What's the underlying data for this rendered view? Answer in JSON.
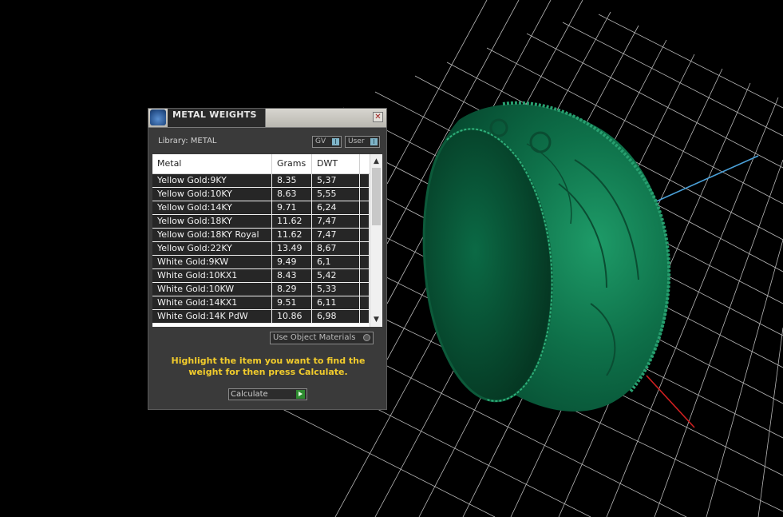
{
  "window": {
    "title": "METAL WEIGHTS",
    "close_label": "✕"
  },
  "library": {
    "label": "Library: METAL",
    "toggle_gv": "GV",
    "toggle_user": "User",
    "toggle_indicator": "I"
  },
  "table": {
    "headers": [
      "Metal",
      "Grams",
      "DWT"
    ],
    "rows": [
      {
        "metal": "Yellow Gold:9KY",
        "grams": "8.35",
        "dwt": "5,37"
      },
      {
        "metal": "Yellow Gold:10KY",
        "grams": "8.63",
        "dwt": "5,55"
      },
      {
        "metal": "Yellow Gold:14KY",
        "grams": "9.71",
        "dwt": "6,24"
      },
      {
        "metal": "Yellow Gold:18KY",
        "grams": "11.62",
        "dwt": "7,47"
      },
      {
        "metal": "Yellow Gold:18KY Royal",
        "grams": "11.62",
        "dwt": "7,47"
      },
      {
        "metal": "Yellow Gold:22KY",
        "grams": "13.49",
        "dwt": "8,67"
      },
      {
        "metal": "White Gold:9KW",
        "grams": "9.49",
        "dwt": "6,1"
      },
      {
        "metal": "White Gold:10KX1",
        "grams": "8.43",
        "dwt": "5,42"
      },
      {
        "metal": "White Gold:10KW",
        "grams": "8.29",
        "dwt": "5,33"
      },
      {
        "metal": "White Gold:14KX1",
        "grams": "9.51",
        "dwt": "6,11"
      },
      {
        "metal": "White Gold:14K PdW",
        "grams": "10.86",
        "dwt": "6,98"
      }
    ]
  },
  "use_object_materials": "Use Object Materials",
  "instruction": "Highlight the item you want to find the weight for then press Calculate.",
  "calculate_label": "Calculate",
  "colors": {
    "panel_bg": "#3a3a3a",
    "ring_green": "#0f6a45",
    "grid": "#d8d8d8",
    "axis_blue": "#4aa0d8",
    "axis_red": "#d02020",
    "instruction_text": "#f2cc2c"
  }
}
